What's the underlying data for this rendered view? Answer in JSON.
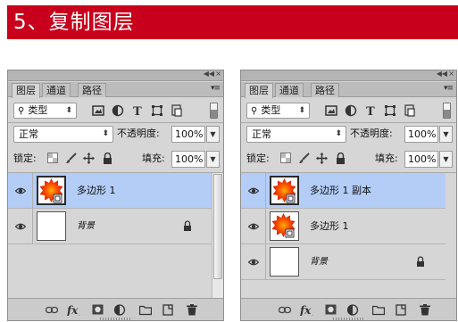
{
  "banner": {
    "title": "5、复制图层",
    "bg_color": "#c8001c",
    "text_color": "#ffffff"
  },
  "panels": [
    {
      "side": "left",
      "tabs": [
        "图层",
        "通道",
        "路径"
      ],
      "active_tab": "图层",
      "filter": {
        "label": "类型",
        "icon": "search-icon"
      },
      "filter_icons": [
        "image-filter-icon",
        "adjustment-filter-icon",
        "type-filter-icon",
        "shape-filter-icon",
        "smart-object-filter-icon"
      ],
      "blend_mode": "正常",
      "opacity_label": "不透明度:",
      "opacity_value": "100%",
      "lock_label": "锁定:",
      "lock_icons": [
        "lock-transparency-icon",
        "lock-paint-icon",
        "lock-position-icon",
        "lock-all-icon"
      ],
      "fill_label": "填充:",
      "fill_value": "100%",
      "layers": [
        {
          "name": "多边形 1",
          "thumbnail": "red-polygon",
          "selected": true,
          "background": false
        },
        {
          "name": "背景",
          "thumbnail": "white",
          "selected": false,
          "background": true,
          "locked": true
        }
      ],
      "bottom_icons": [
        "link-icon",
        "fx-icon",
        "mask-icon",
        "adjustment-icon",
        "folder-icon",
        "new-layer-icon",
        "trash-icon"
      ]
    },
    {
      "side": "right",
      "tabs": [
        "图层",
        "通道",
        "路径"
      ],
      "active_tab": "图层",
      "filter": {
        "label": "类型",
        "icon": "search-icon"
      },
      "filter_icons": [
        "image-filter-icon",
        "adjustment-filter-icon",
        "type-filter-icon",
        "shape-filter-icon",
        "smart-object-filter-icon"
      ],
      "blend_mode": "正常",
      "opacity_label": "不透明度:",
      "opacity_value": "100%",
      "lock_label": "锁定:",
      "lock_icons": [
        "lock-transparency-icon",
        "lock-paint-icon",
        "lock-position-icon",
        "lock-all-icon"
      ],
      "fill_label": "填充:",
      "fill_value": "100%",
      "layers": [
        {
          "name": "多边形 1 副本",
          "thumbnail": "red-polygon",
          "selected": true,
          "background": false
        },
        {
          "name": "多边形 1",
          "thumbnail": "red-polygon",
          "selected": false,
          "background": false
        },
        {
          "name": "背景",
          "thumbnail": "white",
          "selected": false,
          "background": true,
          "locked": true
        }
      ],
      "bottom_icons": [
        "link-icon",
        "fx-icon",
        "mask-icon",
        "adjustment-icon",
        "folder-icon",
        "new-layer-icon",
        "trash-icon"
      ]
    }
  ],
  "colors": {
    "panel_bg": "#d6d6d6",
    "selected_layer": "#b3cdf7",
    "polygon_red": "#e02000",
    "polygon_orange": "#ff8c00"
  }
}
